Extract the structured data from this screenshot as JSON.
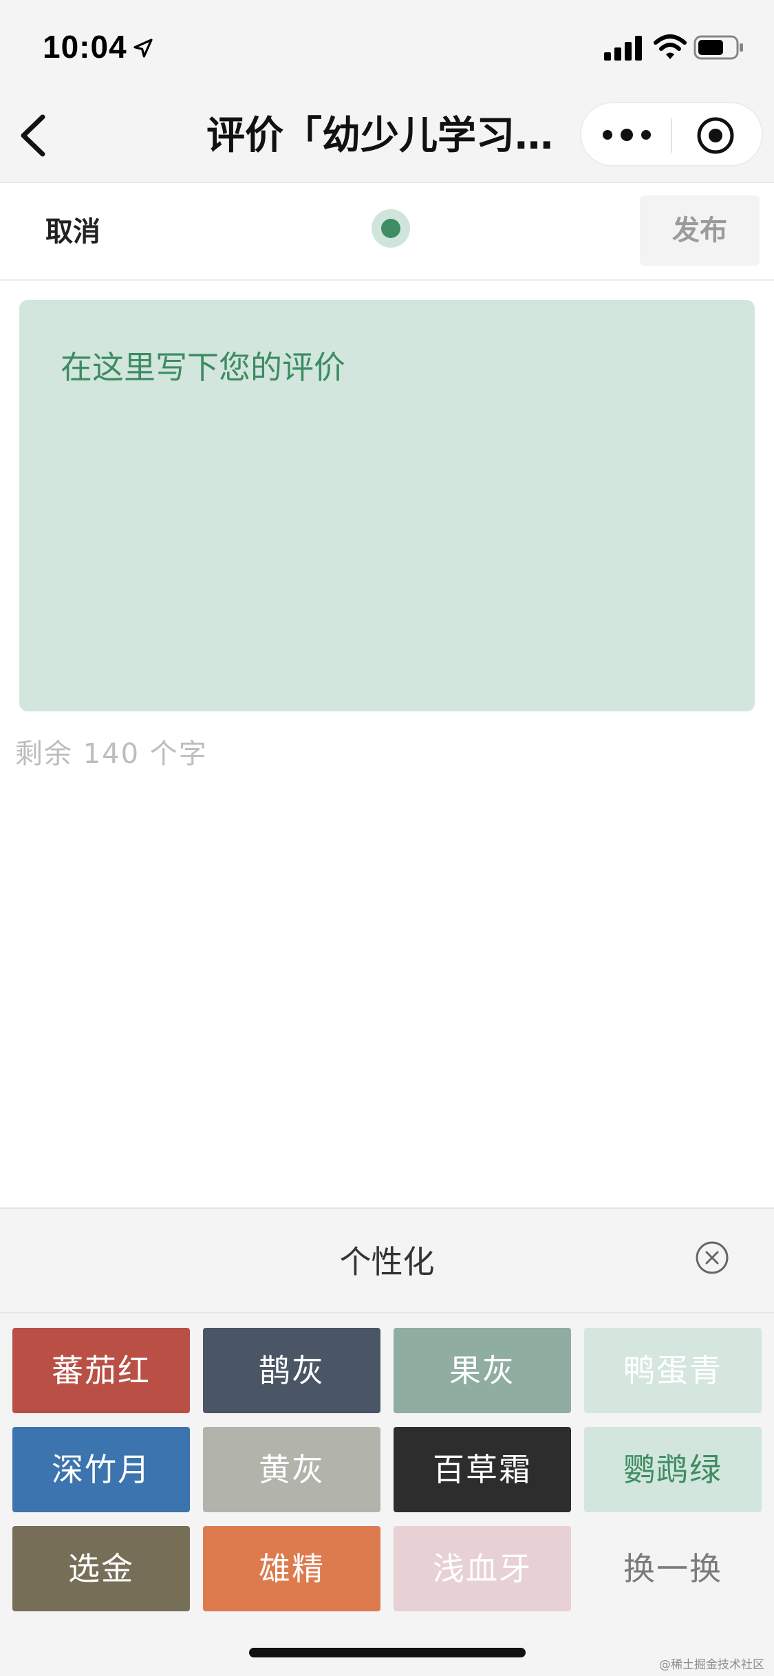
{
  "status_bar": {
    "time": "10:04"
  },
  "nav": {
    "title": "评价「幼少儿学习…"
  },
  "actions": {
    "cancel_label": "取消",
    "publish_label": "发布",
    "current_color": "#3f8d63"
  },
  "editor": {
    "placeholder": "在这里写下您的评价",
    "background": "#d2e6de"
  },
  "counter": {
    "text": "剩余 140 个字"
  },
  "personalize": {
    "title": "个性化",
    "swatches": [
      {
        "label": "蕃茄红",
        "bg": "#b94f45",
        "fg": "#ffffff"
      },
      {
        "label": "鹊灰",
        "bg": "#4a5565",
        "fg": "#ffffff"
      },
      {
        "label": "果灰",
        "bg": "#8fada1",
        "fg": "#ffffff"
      },
      {
        "label": "鸭蛋青",
        "bg": "#d5e6df",
        "fg": "#ffffff"
      },
      {
        "label": "深竹月",
        "bg": "#3b74ae",
        "fg": "#ffffff"
      },
      {
        "label": "黄灰",
        "bg": "#b2b4ac",
        "fg": "#ffffff"
      },
      {
        "label": "百草霜",
        "bg": "#2d2d2d",
        "fg": "#ffffff"
      },
      {
        "label": "鹦鹉绿",
        "bg": "#d2e6de",
        "fg": "#3d8c61"
      },
      {
        "label": "选金",
        "bg": "#766e57",
        "fg": "#ffffff"
      },
      {
        "label": "雄精",
        "bg": "#dd7b4e",
        "fg": "#ffffff"
      },
      {
        "label": "浅血牙",
        "bg": "#e7d1d4",
        "fg": "#ffffff"
      }
    ],
    "swap_label": "换一换"
  },
  "watermark": "@稀土掘金技术社区"
}
